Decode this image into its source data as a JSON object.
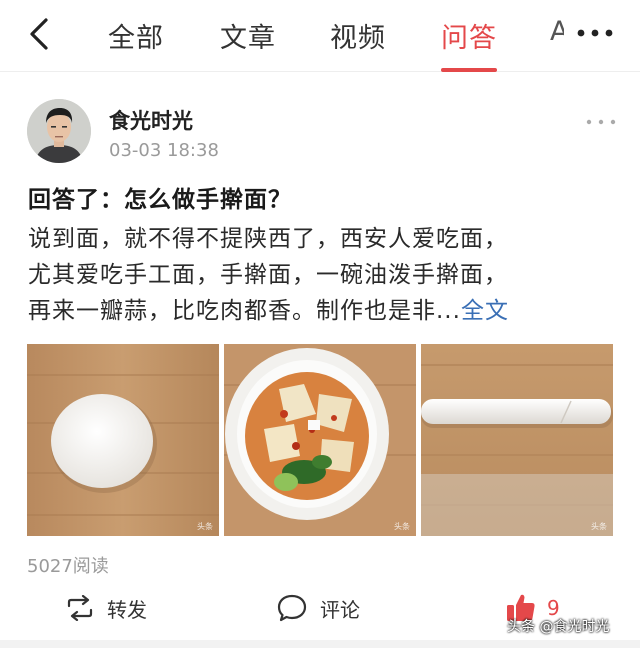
{
  "nav": {
    "tabs": [
      "全部",
      "文章",
      "视频",
      "问答"
    ],
    "active_tab": "问答",
    "partial_tab": "A",
    "accent_color": "#e4484a"
  },
  "post": {
    "author": "食光时光",
    "time": "03-03 18:38",
    "title": "回答了：怎么做手擀面？",
    "body_lines": [
      "说到面，就不得不提陕西了，西安人爱吃面，",
      "尤其爱吃手工面，手擀面，一碗油泼手擀面，",
      "再来一瓣蒜，比吃肉都香。制作也是非..."
    ],
    "full_text_link": "全文",
    "images": [
      {
        "icon": "dough-ball-photo",
        "watermark": "头条"
      },
      {
        "icon": "noodle-bowl-photo",
        "watermark": "头条"
      },
      {
        "icon": "dough-roll-photo",
        "watermark": "头条"
      }
    ],
    "read_count": "5027阅读"
  },
  "actions": {
    "repost_label": "转发",
    "comment_label": "评论",
    "like_count": "9"
  },
  "watermark": "头条 @食光时光"
}
